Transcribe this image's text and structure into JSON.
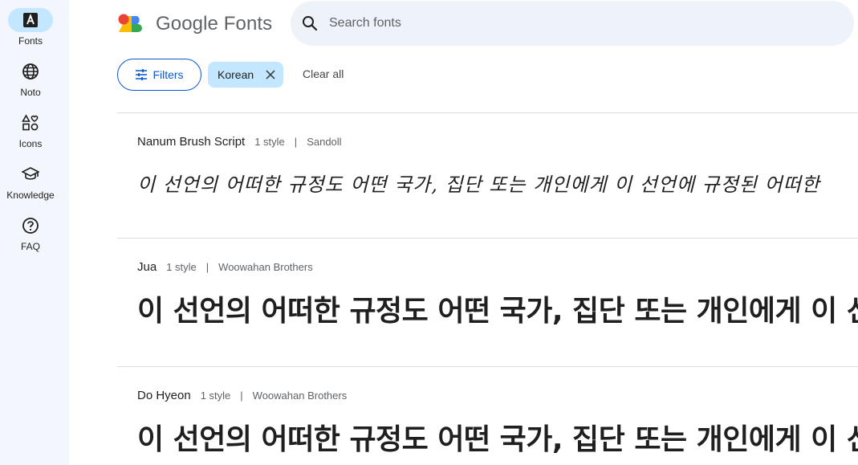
{
  "app": {
    "logo_text": "Google Fonts",
    "brand_colors": [
      "#ea4335",
      "#fbbc04",
      "#34a853",
      "#4285f4"
    ]
  },
  "nav": {
    "items": [
      {
        "label": "Fonts",
        "icon": "font-a-icon",
        "active": true
      },
      {
        "label": "Noto",
        "icon": "globe-icon",
        "active": false
      },
      {
        "label": "Icons",
        "icon": "shapes-icon",
        "active": false
      },
      {
        "label": "Knowledge",
        "icon": "graduation-cap-icon",
        "active": false
      },
      {
        "label": "FAQ",
        "icon": "help-circle-icon",
        "active": false
      }
    ]
  },
  "search": {
    "placeholder": "Search fonts",
    "value": ""
  },
  "filters": {
    "button_label": "Filters",
    "active_chips": [
      {
        "label": "Korean"
      }
    ],
    "clear_all_label": "Clear all"
  },
  "fonts": [
    {
      "name": "Nanum Brush Script",
      "styles": "1 style",
      "separator": "|",
      "foundry": "Sandoll",
      "sample": "이 선언의 어떠한 규정도 어떤 국가, 집단 또는 개인에게 이 선언에 규정된 어떠한"
    },
    {
      "name": "Jua",
      "styles": "1 style",
      "separator": "|",
      "foundry": "Woowahan Brothers",
      "sample": "이 선언의 어떠한 규정도 어떤 국가, 집단 또는 개인에게 이 선언에"
    },
    {
      "name": "Do Hyeon",
      "styles": "1 style",
      "separator": "|",
      "foundry": "Woowahan Brothers",
      "sample": "이 선언의 어떠한 규정도 어떤 국가, 집단 또는 개인에게 이 선언에"
    }
  ],
  "colors": {
    "accent": "#0b57d0",
    "chip_bg": "#c2e7ff",
    "rail_bg": "#f3f6fc",
    "search_bg": "#eef2f9"
  }
}
